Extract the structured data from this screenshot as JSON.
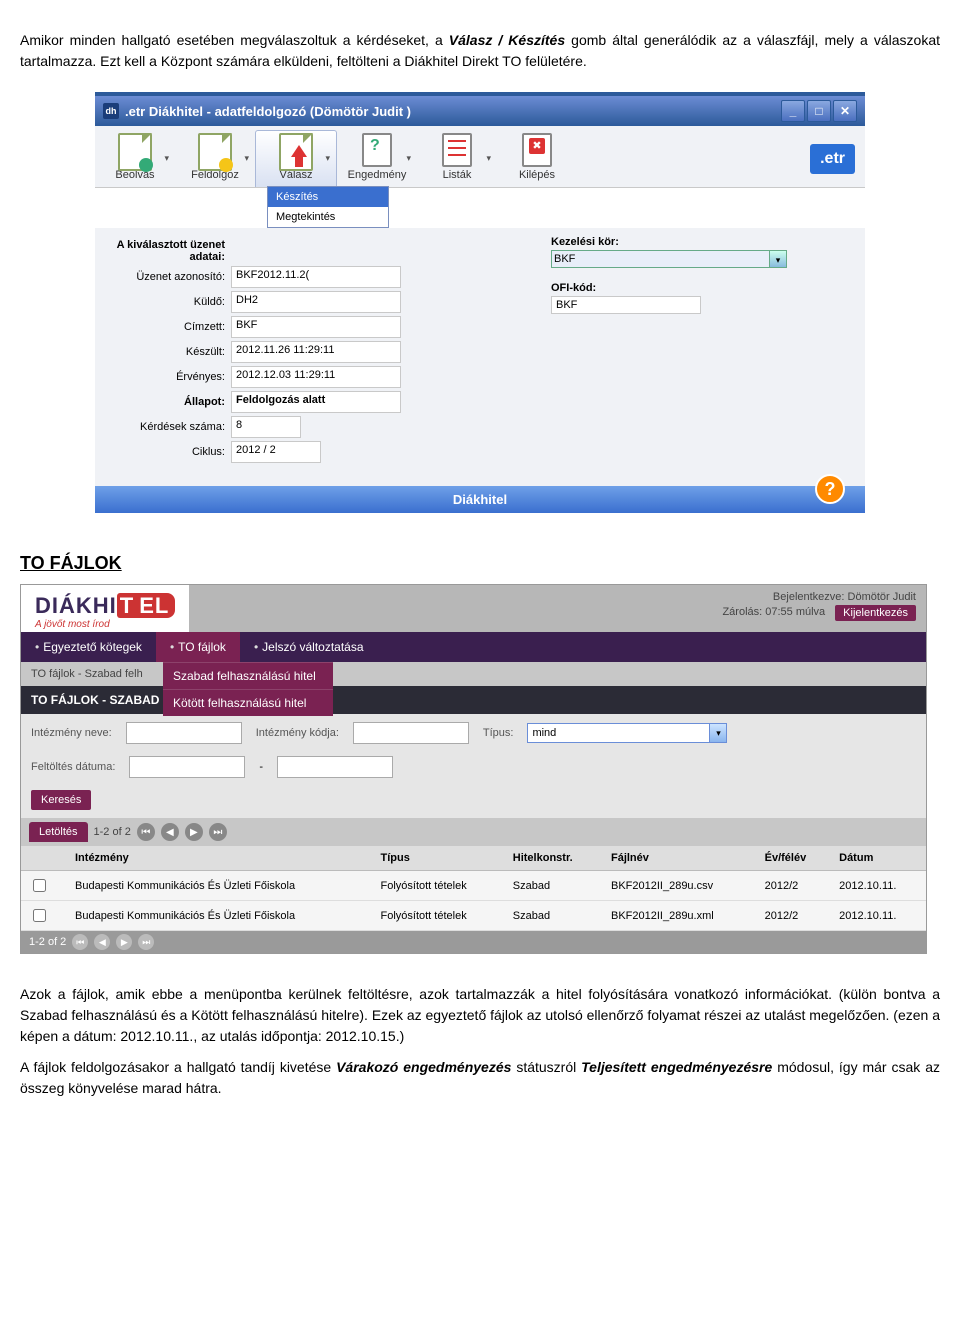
{
  "para1": {
    "t1": "Amikor minden hallgató esetében megválaszoltuk a kérdéseket, a ",
    "b1": "Válasz / Készítés",
    "t2": " gomb által generálódik az a válaszfájl, mely a válaszokat tartalmazza. Ezt kell a Központ számára elküldeni, feltölteni a Diákhitel Direkt TO felületére."
  },
  "win": {
    "title": ".etr Diákhitel - adatfeldolgozó (Dömötör Judit )",
    "toolbar": {
      "beolvas": "Beolvas",
      "feldolgoz": "Feldolgoz",
      "valasz": "Válasz",
      "engedmeny": "Engedmény",
      "listak": "Listák",
      "kilepes": "Kilépés",
      "etr": ".etr"
    },
    "menu": {
      "keszites": "Készítés",
      "megtekintes": "Megtekintés"
    },
    "section_label": "A kiválasztott üzenet adatai:",
    "fields": {
      "uzenet_lbl": "Üzenet azonosító:",
      "uzenet_val": "BKF2012.11.2(",
      "kuldo_lbl": "Küldő:",
      "kuldo_val": "DH2",
      "cimzett_lbl": "Címzett:",
      "cimzett_val": "BKF",
      "keszult_lbl": "Készült:",
      "keszult_val": "2012.11.26 11:29:11",
      "ervenyes_lbl": "Érvényes:",
      "ervenyes_val": "2012.12.03 11:29:11",
      "allapot_lbl": "Állapot:",
      "allapot_val": "Feldolgozás alatt",
      "kerd_lbl": "Kérdések száma:",
      "kerd_val": "8",
      "ciklus_lbl": "Ciklus:",
      "ciklus_val": "2012 / 2"
    },
    "right": {
      "kezkor_lbl": "Kezelési kör:",
      "kezkor_val": "BKF",
      "ofi_lbl": "OFI-kód:",
      "ofi_val": "BKF"
    },
    "footer": "Diákhitel",
    "help": "?"
  },
  "section_title": "TO FÁJLOK",
  "dh": {
    "logo_pre": "DIÁKHI",
    "logo_t": "T",
    "logo_el": "EL",
    "tagline": "A jövőt most írod",
    "logged": "Bejelentkezve: Dömötör Judit",
    "zaro": "Zárolás: 07:55 múlva",
    "logout": "Kijelentkezés",
    "nav1": "Egyeztető kötegek",
    "nav2": "TO fájlok",
    "nav3": "Jelszó változtatása",
    "sub1": "Szabad felhasználású hitel",
    "sub2": "Kötött felhasználású hitel",
    "crumb": "TO fájlok - Szabad felh",
    "band": "TO FÁJLOK - SZABAD FELHASZNÁLÁSÚ HITEL",
    "f_intnev": "Intézmény neve:",
    "f_intkod": "Intézmény kódja:",
    "f_tipus": "Típus:",
    "f_tipus_val": "mind",
    "f_felt": "Feltöltés dátuma:",
    "dash": "-",
    "search": "Keresés",
    "tab": "Letöltés",
    "pager": "1-2 of 2",
    "th": {
      "int": "Intézmény",
      "tip": "Típus",
      "hk": "Hitelkonstr.",
      "fn": "Fájlnév",
      "ev": "Év/félév",
      "dt": "Dátum"
    },
    "rows": [
      {
        "int": "Budapesti Kommunikációs És Üzleti Főiskola",
        "tip": "Folyósított tételek",
        "hk": "Szabad",
        "fn": "BKF2012II_289u.csv",
        "ev": "2012/2",
        "dt": "2012.10.11."
      },
      {
        "int": "Budapesti Kommunikációs És Üzleti Főiskola",
        "tip": "Folyósított tételek",
        "hk": "Szabad",
        "fn": "BKF2012II_289u.xml",
        "ev": "2012/2",
        "dt": "2012.10.11."
      }
    ]
  },
  "para2": {
    "t1": "Azok a fájlok, amik ebbe a menüpontba kerülnek feltöltésre, azok tartalmazzák a hitel folyósítására vonatkozó információkat. (külön bontva a Szabad felhasználású és a Kötött felhasználású hitelre). Ezek az egyeztető fájlok az utolsó ellenőrző folyamat részei az utalást megelőzően. (ezen a képen a dátum: 2012.10.11., az utalás időpontja: 2012.10.15.)"
  },
  "para3": {
    "t1": "A fájlok feldolgozásakor a hallgató tandíj kivetése ",
    "b1": "Várakozó engedményezés",
    "t2": " státuszról ",
    "b2": "Teljesített engedményezésre",
    "t3": " módosul, így már csak az összeg könyvelése marad hátra."
  }
}
